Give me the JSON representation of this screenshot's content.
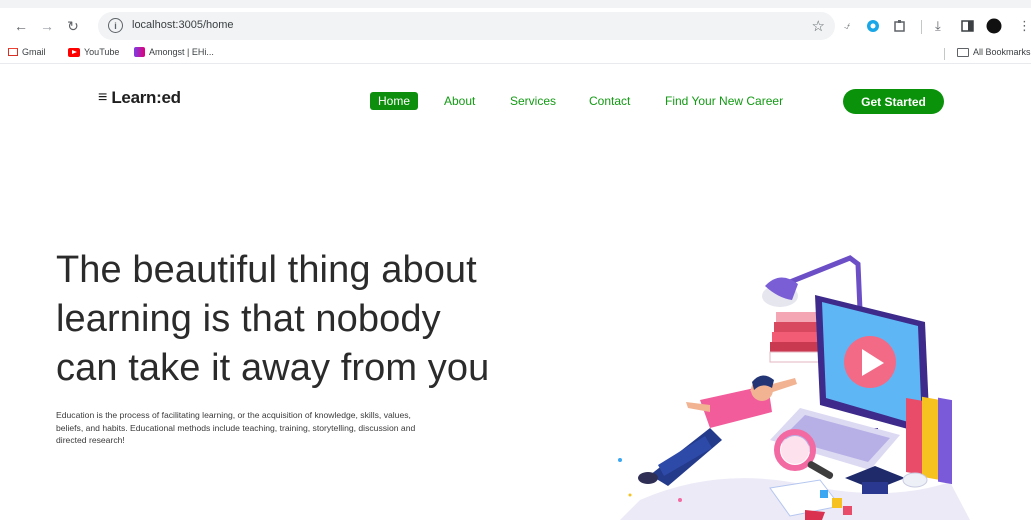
{
  "browser": {
    "url": "localhost:3005/home",
    "bookmarks": [
      {
        "label": "Gmail",
        "icon": "gmail-icon"
      },
      {
        "label": "YouTube",
        "icon": "youtube-icon"
      },
      {
        "label": "Amongst | EHi...",
        "icon": "amongst-icon"
      }
    ],
    "all_bookmarks": "All Bookmarks"
  },
  "site": {
    "logo": "Learn:ed",
    "nav": [
      {
        "label": "Home",
        "active": true
      },
      {
        "label": "About"
      },
      {
        "label": "Services"
      },
      {
        "label": "Contact"
      },
      {
        "label": "Find Your New Career"
      }
    ],
    "cta": "Get Started"
  },
  "hero": {
    "title_lines": [
      "The beautiful thing about",
      "learning is that nobody",
      "can take it away from you"
    ],
    "description_lines": [
      "Education is the process of facilitating learning, or the acquisition of knowledge, skills, values,",
      "beliefs, and habits. Educational methods include teaching, training, storytelling, discussion and",
      "directed research!"
    ]
  },
  "colors": {
    "brand_green": "#0a920a",
    "nav_green": "#139a14",
    "title_text": "#2b2b2b"
  }
}
